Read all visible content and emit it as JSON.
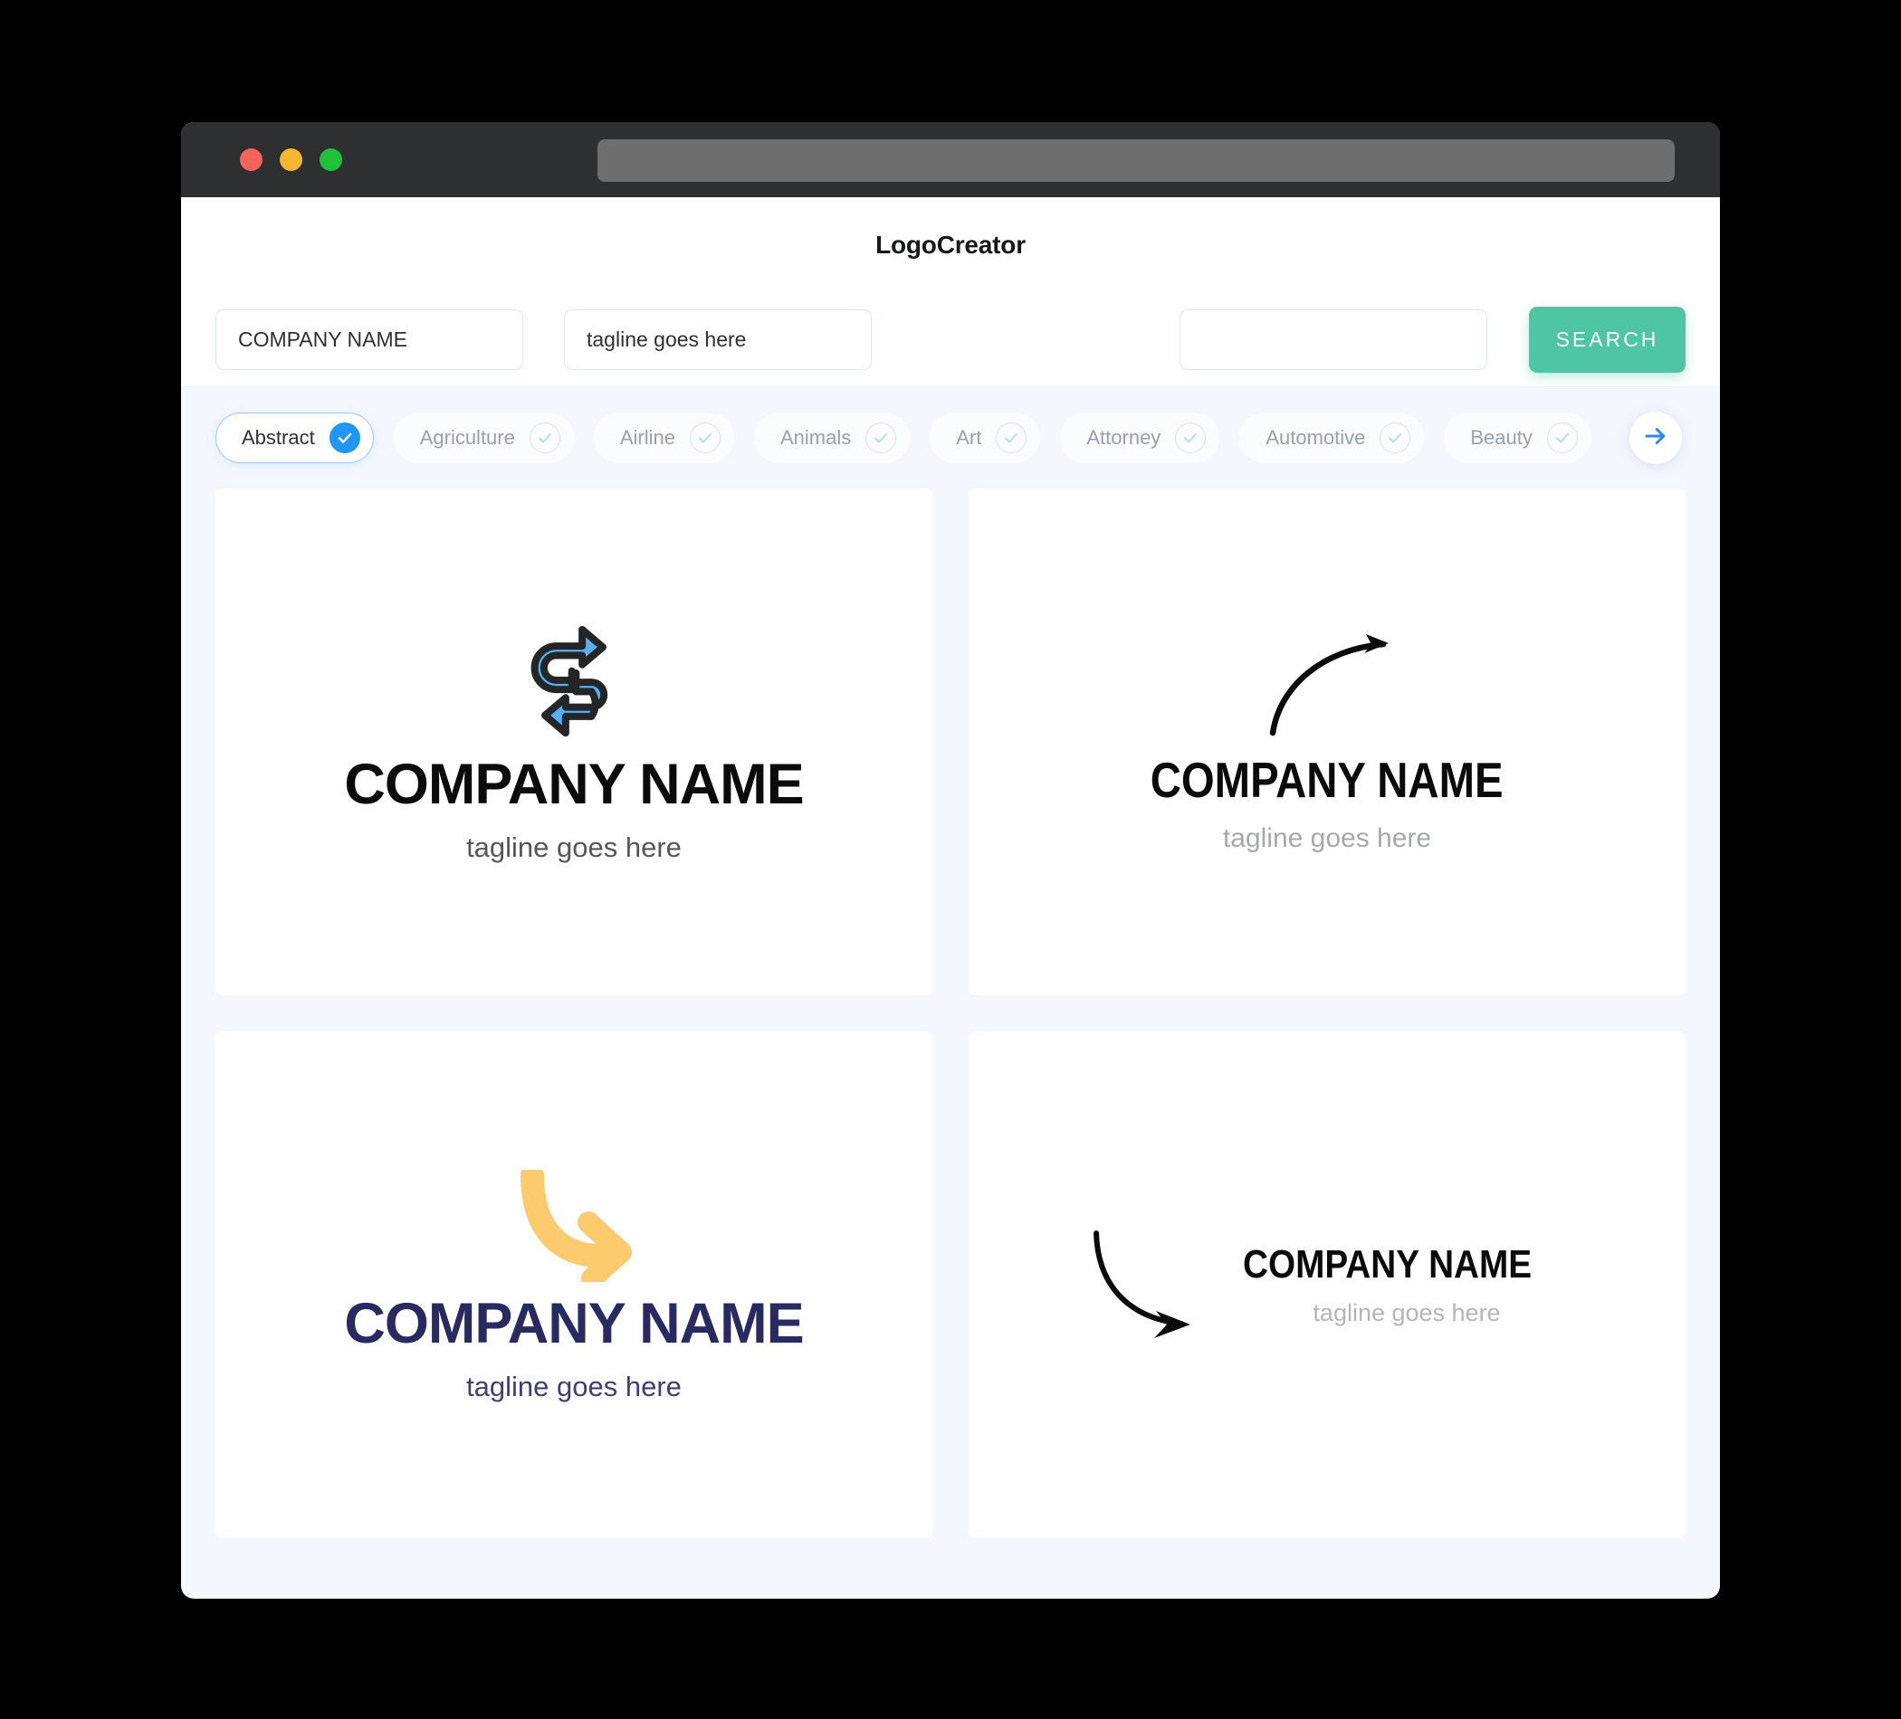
{
  "window": {
    "traffic_lights": [
      {
        "name": "close",
        "color": "#F4645A"
      },
      {
        "name": "minimize",
        "color": "#F5B731"
      },
      {
        "name": "maximize",
        "color": "#20C13A"
      }
    ],
    "url_bar_value": ""
  },
  "header": {
    "title": "LogoCreator"
  },
  "search": {
    "company_value": "COMPANY NAME",
    "company_placeholder": "COMPANY NAME",
    "tagline_value": "tagline goes here",
    "tagline_placeholder": "tagline goes here",
    "extra_value": "",
    "extra_placeholder": "",
    "button_label": "SEARCH",
    "button_color": "#4EC6A1"
  },
  "categories": {
    "next_icon": "arrow-right-icon",
    "accent_color": "#2196F3",
    "items": [
      {
        "label": "Abstract",
        "selected": true
      },
      {
        "label": "Agriculture",
        "selected": false
      },
      {
        "label": "Airline",
        "selected": false
      },
      {
        "label": "Animals",
        "selected": false
      },
      {
        "label": "Art",
        "selected": false
      },
      {
        "label": "Attorney",
        "selected": false
      },
      {
        "label": "Automotive",
        "selected": false
      },
      {
        "label": "Beauty",
        "selected": false
      }
    ]
  },
  "logos": [
    {
      "id": "logo-1",
      "icon": "sync-arrows-icon",
      "icon_color": "#58AFF4",
      "icon_outline": "#232527",
      "name": "COMPANY NAME",
      "tagline": "tagline goes here",
      "name_color": "#0B0B0C",
      "tagline_color": "#55565A"
    },
    {
      "id": "logo-2",
      "icon": "curved-arrow-up-right-icon",
      "icon_color": "#0B0B0C",
      "name": "COMPANY NAME",
      "tagline": "tagline goes here",
      "name_color": "#0B0B0C",
      "tagline_color": "#A7A8AC"
    },
    {
      "id": "logo-3",
      "icon": "curved-arrow-down-right-icon",
      "icon_color": "#FBCB6E",
      "name": "COMPANY NAME",
      "tagline": "tagline goes here",
      "name_color": "#2A2A63",
      "tagline_color": "#3E3E79"
    },
    {
      "id": "logo-4",
      "icon": "curved-arrow-down-right-thin-icon",
      "icon_color": "#0B0B0C",
      "name": "COMPANY NAME",
      "tagline": "tagline goes here",
      "name_color": "#0B0B0C",
      "tagline_color": "#B4B5B9"
    }
  ]
}
